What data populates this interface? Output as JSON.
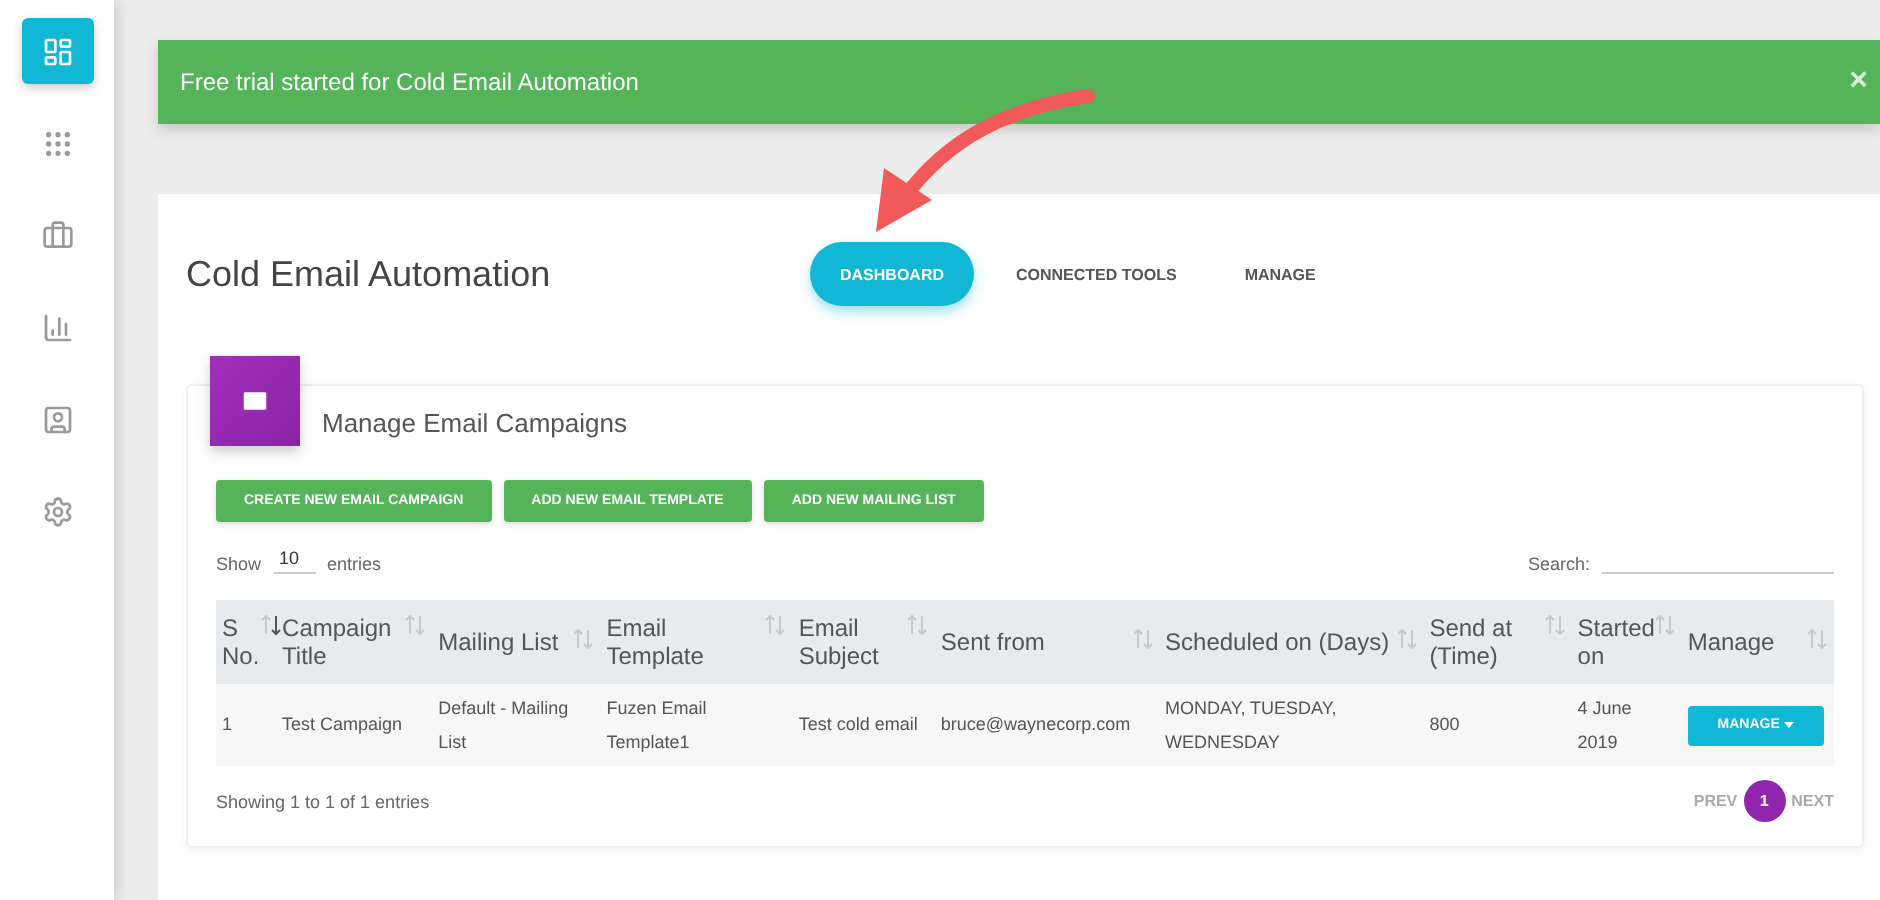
{
  "sidebar": {
    "items": [
      {
        "selected": true
      },
      {
        "selected": false
      },
      {
        "selected": false
      },
      {
        "selected": false
      },
      {
        "selected": false
      },
      {
        "selected": false
      }
    ]
  },
  "alert": {
    "message": "Free trial started for Cold Email Automation",
    "close": "×"
  },
  "page": {
    "title": "Cold Email Automation",
    "tabs": [
      {
        "label": "DASHBOARD",
        "selected": true
      },
      {
        "label": "CONNECTED TOOLS",
        "selected": false
      },
      {
        "label": "MANAGE",
        "selected": false
      }
    ]
  },
  "panel": {
    "title": "Manage Email Campaigns",
    "buttons": [
      "CREATE NEW EMAIL CAMPAIGN",
      "ADD NEW EMAIL TEMPLATE",
      "ADD NEW MAILING LIST"
    ],
    "length": {
      "before": "Show",
      "value": "10",
      "after": "entries"
    },
    "search": {
      "label": "Search:"
    },
    "table": {
      "columns": [
        {
          "label": "S No.",
          "selected": true
        },
        {
          "label": "Campaign Title",
          "selected": false
        },
        {
          "label": "Mailing List",
          "selected": false
        },
        {
          "label": "Email Template",
          "selected": false
        },
        {
          "label": "Email Subject",
          "selected": false
        },
        {
          "label": "Sent from",
          "selected": false
        },
        {
          "label": "Scheduled on (Days)",
          "selected": false
        },
        {
          "label": "Send at (Time)",
          "selected": false
        },
        {
          "label": "Started on",
          "selected": false
        },
        {
          "label": "Manage",
          "selected": false
        }
      ],
      "rows": [
        {
          "cells": [
            "1",
            "Test Campaign",
            "Default - Mailing List",
            "Fuzen Email Template1",
            "Test cold email",
            "bruce@waynecorp.com",
            "MONDAY, TUESDAY, WEDNESDAY",
            "800",
            "4 June 2019"
          ],
          "action": "MANAGE"
        }
      ]
    },
    "info": "Showing 1 to 1 of 1 entries",
    "pagination": {
      "prev": "PREV",
      "pages": [
        {
          "label": "1",
          "selected": true
        }
      ],
      "next": "NEXT"
    }
  }
}
